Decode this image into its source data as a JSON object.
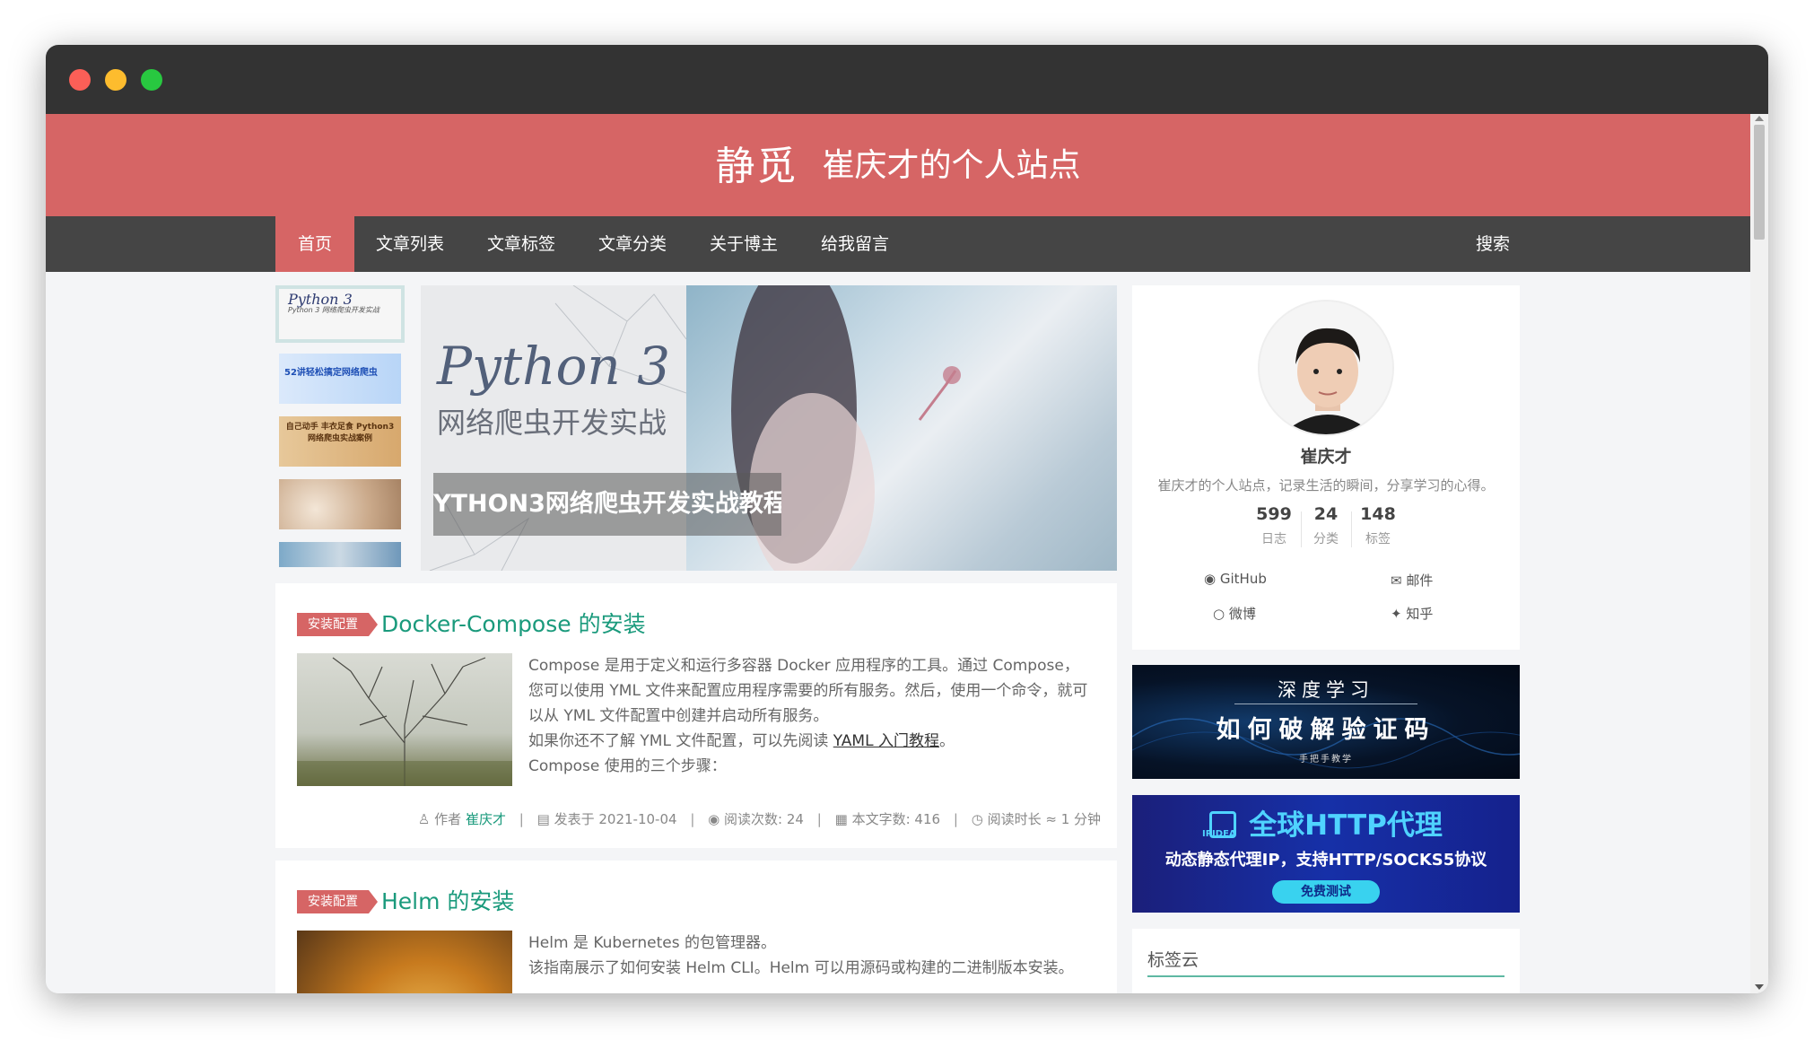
{
  "site": {
    "name": "静觅",
    "subtitle": "崔庆才的个人站点"
  },
  "nav": {
    "items": [
      {
        "label": "首页",
        "active": true
      },
      {
        "label": "文章列表"
      },
      {
        "label": "文章标签"
      },
      {
        "label": "文章分类"
      },
      {
        "label": "关于博主"
      },
      {
        "label": "给我留言"
      }
    ],
    "search_label": "搜索"
  },
  "carousel": {
    "caption": "YTHON3网络爬虫开发实战教程",
    "cover_title": "Python 3",
    "cover_subtitle": "网络爬虫开发实战",
    "thumbnails": [
      {
        "text": "Python 3 网络爬虫开发实战"
      },
      {
        "text": "52讲轻松搞定网络爬虫"
      },
      {
        "text": "自己动手 丰衣足食 Python3网络爬虫实战案例"
      },
      {
        "text": ""
      },
      {
        "text": ""
      }
    ]
  },
  "posts": [
    {
      "tag": "安装配置",
      "title": "Docker-Compose 的安装",
      "excerpt_line1": "Compose 是用于定义和运行多容器 Docker 应用程序的工具。通过 Compose，您可以使用 YML 文件来配置应用程序需要的所有服务。然后，使用一个命令，就可以从 YML 文件配置中创建并启动所有服务。",
      "excerpt_line2_prefix": "如果你还不了解 YML 文件配置，可以先阅读 ",
      "excerpt_link": "YAML 入门教程",
      "excerpt_line2_suffix": "。",
      "excerpt_line3": "Compose 使用的三个步骤：",
      "meta": {
        "author_label": "作者",
        "author": "崔庆才",
        "date_label": "发表于",
        "date": "2021-10-04",
        "views_label": "阅读次数:",
        "views": "24",
        "words_label": "本文字数:",
        "words": "416",
        "time_label": "阅读时长 ≈",
        "time": "1 分钟"
      }
    },
    {
      "tag": "安装配置",
      "title": "Helm 的安装",
      "excerpt_line1": "Helm 是 Kubernetes 的包管理器。",
      "excerpt_line2": "该指南展示了如何安装 Helm CLI。Helm 可以用源码或构建的二进制版本安装。"
    }
  ],
  "profile": {
    "name": "崔庆才",
    "description": "崔庆才的个人站点，记录生活的瞬间，分享学习的心得。",
    "stats": [
      {
        "value": "599",
        "label": "日志"
      },
      {
        "value": "24",
        "label": "分类"
      },
      {
        "value": "148",
        "label": "标签"
      }
    ],
    "links": {
      "github": "GitHub",
      "email": "邮件",
      "weibo": "微博",
      "zhihu": "知乎"
    }
  },
  "ads": {
    "ad1": {
      "line1": "深度学习",
      "line2": "如何破解验证码",
      "line3": "手把手教学"
    },
    "ad2": {
      "logo_text": "IPIDEA",
      "line1": "全球HTTP代理",
      "line2": "动态静态代理IP，支持HTTP/SOCKS5协议",
      "button": "免费测试"
    }
  },
  "tagcloud": {
    "title": "标签云"
  },
  "colors": {
    "accent": "#d66565",
    "nav_bg": "#454545",
    "link_green": "#1a9a7c"
  }
}
